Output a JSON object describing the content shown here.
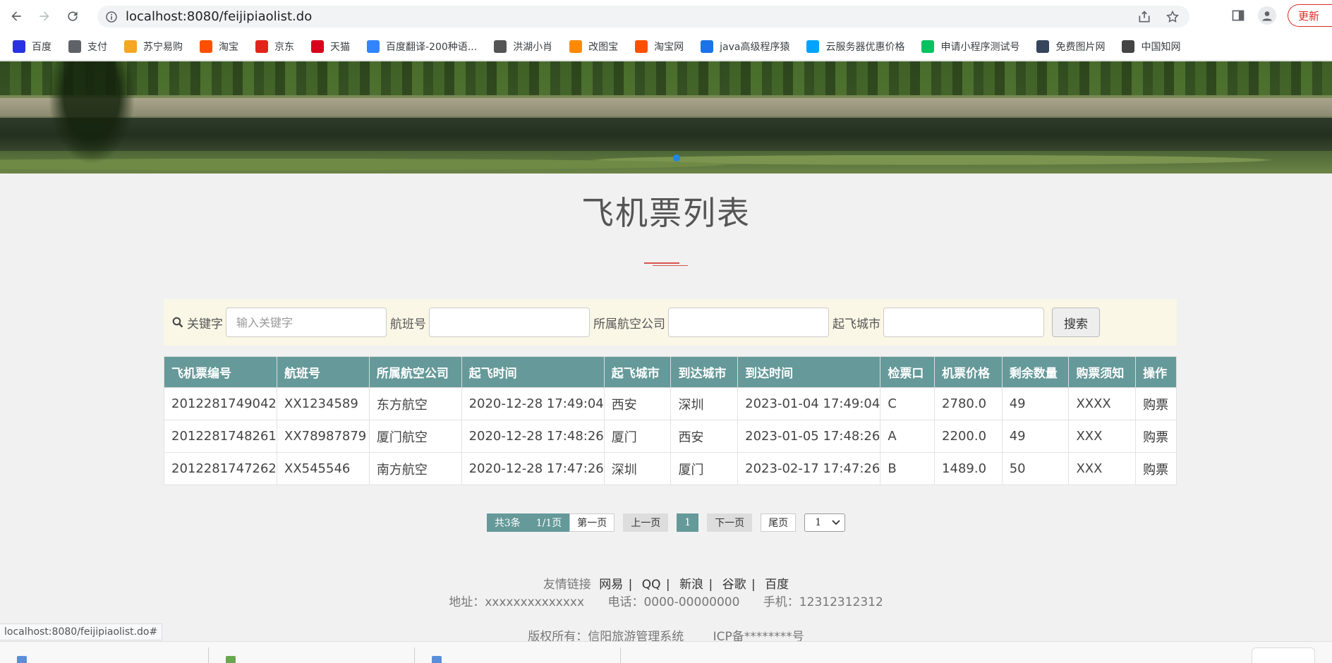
{
  "browser": {
    "url": "localhost:8080/feijipiaolist.do",
    "update_label": "更新",
    "bookmarks": [
      {
        "label": "百度",
        "icon": "baidu-icon",
        "color": "#2932e1"
      },
      {
        "label": "支付",
        "icon": "globe-icon",
        "color": "#5f6368"
      },
      {
        "label": "苏宁易购",
        "icon": "suning-icon",
        "color": "#f5a623"
      },
      {
        "label": "淘宝",
        "icon": "taobao-icon",
        "color": "#ff5000"
      },
      {
        "label": "京东",
        "icon": "jd-icon",
        "color": "#e1251b"
      },
      {
        "label": "天猫",
        "icon": "tmall-icon",
        "color": "#d9001b"
      },
      {
        "label": "百度翻译-200种语...",
        "icon": "translate-icon",
        "color": "#3385ff"
      },
      {
        "label": "洪湖小肖",
        "icon": "bird-icon",
        "color": "#555555"
      },
      {
        "label": "改图宝",
        "icon": "gaitubao-icon",
        "color": "#ff8a00"
      },
      {
        "label": "淘宝网",
        "icon": "taobao-icon",
        "color": "#ff5000"
      },
      {
        "label": "java高级程序猿",
        "icon": "robot-icon",
        "color": "#1a73e8"
      },
      {
        "label": "云服务器优惠价格",
        "icon": "cloud-icon",
        "color": "#00a3ff"
      },
      {
        "label": "申请小程序测试号",
        "icon": "wechat-icon",
        "color": "#07c160"
      },
      {
        "label": "免费图片网",
        "icon": "tumblr-icon",
        "color": "#35465c"
      },
      {
        "label": "中国知网",
        "icon": "cnki-icon",
        "color": "#444444"
      }
    ],
    "status_url": "localhost:8080/feijipiaolist.do#"
  },
  "page": {
    "title": "飞机票列表"
  },
  "search": {
    "keyword_label": "关键字",
    "keyword_placeholder": "输入关键字",
    "flight_label": "航班号",
    "airline_label": "所属航空公司",
    "city_label": "起飞城市",
    "button_label": "搜索"
  },
  "table": {
    "headers": [
      "飞机票编号",
      "航班号",
      "所属航空公司",
      "起飞时间",
      "起飞城市",
      "到达城市",
      "到达时间",
      "检票口",
      "机票价格",
      "剩余数量",
      "购票须知",
      "操作"
    ],
    "rows": [
      [
        "2012281749042",
        "XX1234589",
        "东方航空",
        "2020-12-28 17:49:04",
        "西安",
        "深圳",
        "2023-01-04 17:49:04",
        "C",
        "2780.0",
        "49",
        "XXXX",
        "购票"
      ],
      [
        "2012281748261",
        "XX78987879",
        "厦门航空",
        "2020-12-28 17:48:26",
        "厦门",
        "西安",
        "2023-01-05 17:48:26",
        "A",
        "2200.0",
        "49",
        "XXX",
        "购票"
      ],
      [
        "2012281747262",
        "XX545546",
        "南方航空",
        "2020-12-28 17:47:26",
        "深圳",
        "厦门",
        "2023-02-17 17:47:26",
        "B",
        "1489.0",
        "50",
        "XXX",
        "购票"
      ]
    ]
  },
  "pager": {
    "total": "共3条",
    "pages": "1/1页",
    "first": "第一页",
    "prev": "上一页",
    "current": "1",
    "next": "下一页",
    "last": "尾页",
    "select_value": "1"
  },
  "footer": {
    "links_label": "友情链接",
    "links": [
      "网易",
      "QQ",
      "新浪",
      "谷歌",
      "百度"
    ],
    "address": "地址：xxxxxxxxxxxxxx",
    "phone": "电话：0000-00000000",
    "mobile": "手机：12312312312",
    "copyright": "版权所有：信阳旅游管理系统",
    "icp": "ICP备********号"
  },
  "colors": {
    "accent": "#669999",
    "search_bg": "#faf7e6",
    "title_deco": "#d9534f"
  }
}
